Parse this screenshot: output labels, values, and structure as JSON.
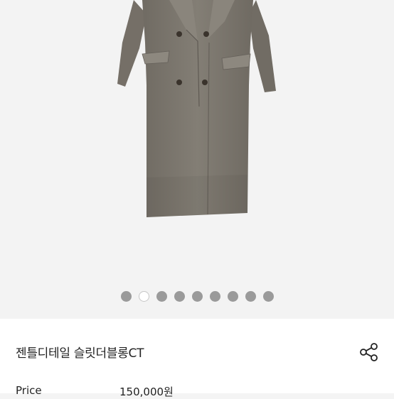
{
  "gallery": {
    "image_alt": "coat-product-photo",
    "dot_count": 9,
    "active_index": 1
  },
  "product": {
    "title": "젠틀디테일 슬릿더블롱CT",
    "price_label": "Price",
    "price_value": "150,000원"
  },
  "icons": {
    "share": "share-icon"
  },
  "colors": {
    "dot_inactive": "#9a9a9a",
    "dot_active": "#ffffff",
    "coat": "#7d786f"
  }
}
